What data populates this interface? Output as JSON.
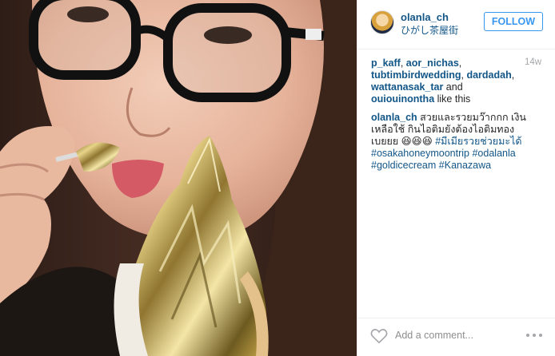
{
  "photo": {
    "icon": "photo-of-woman-eating-gold-leaf-ice-cream"
  },
  "header": {
    "username": "olanla_ch",
    "location": "ひがし茶屋街",
    "follow_label": "FOLLOW",
    "avatar_icon": "profile-avatar"
  },
  "likes": {
    "users": [
      "p_kaff",
      "aor_nichas",
      "tubtimbirdwedding",
      "dardadah",
      "wattanasak_tar",
      "ouiouinontha"
    ],
    "sep1": ", ",
    "sep2": ", ",
    "sep3": ", ",
    "sep4": ", ",
    "and_text": " and ",
    "suffix": " like this"
  },
  "time": "14w",
  "caption": {
    "user": "olanla_ch",
    "text": " สวยและรวยมว๊ากกก เงินเหลือใช้ กินไอติมยังต้องไอติมทอง เบยยย 😆😆😆 ",
    "tags": [
      "#มีเมียรวยช่วยมะได้",
      "#osakahoneymoontrip",
      "#odalanla",
      "#goldicecream",
      "#Kanazawa"
    ]
  },
  "comment_bar": {
    "placeholder": "Add a comment...",
    "like_icon": "heart-icon",
    "more_icon": "more-options-icon"
  },
  "colors": {
    "link": "#125688",
    "follow_blue": "#3897f0",
    "muted": "#a5a7aa",
    "gold": "#c9a94a"
  }
}
